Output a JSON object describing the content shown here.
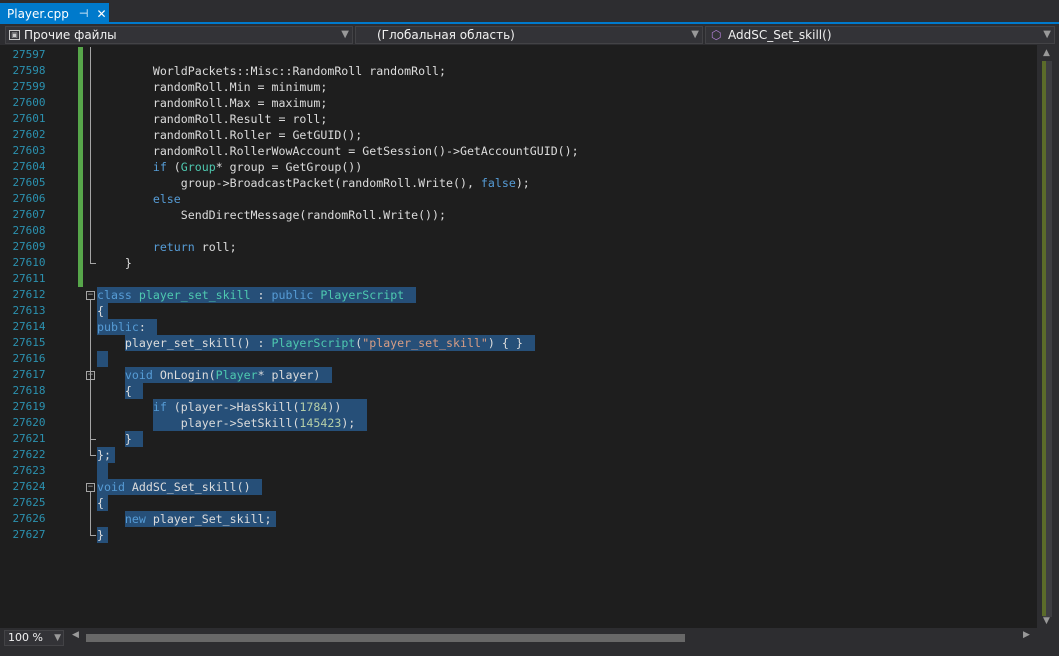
{
  "tab": {
    "title": "Player.cpp",
    "pin": "⊣",
    "close": "✕"
  },
  "navbar": {
    "project": "Прочие файлы",
    "scope": "(Глобальная область)",
    "member": "AddSC_Set_skill()"
  },
  "zoom": "100 %",
  "lines": [
    {
      "n": "27597",
      "s": []
    },
    {
      "n": "27598",
      "s": [
        [
          "t",
          "        WorldPackets::Misc::RandomRoll randomRoll;"
        ]
      ]
    },
    {
      "n": "27599",
      "s": [
        [
          "t",
          "        randomRoll.Min = minimum;"
        ]
      ]
    },
    {
      "n": "27600",
      "s": [
        [
          "t",
          "        randomRoll.Max = maximum;"
        ]
      ]
    },
    {
      "n": "27601",
      "s": [
        [
          "t",
          "        randomRoll.Result = roll;"
        ]
      ]
    },
    {
      "n": "27602",
      "s": [
        [
          "t",
          "        randomRoll.Roller = GetGUID();"
        ]
      ]
    },
    {
      "n": "27603",
      "s": [
        [
          "t",
          "        randomRoll.RollerWowAccount = GetSession()->GetAccountGUID();"
        ]
      ]
    },
    {
      "n": "27604",
      "s": [
        [
          "k",
          "        if"
        ],
        [
          "t",
          " ("
        ],
        [
          "y",
          "Group"
        ],
        [
          "t",
          "* group = GetGroup())"
        ]
      ]
    },
    {
      "n": "27605",
      "s": [
        [
          "t",
          "            group->BroadcastPacket(randomRoll.Write(), "
        ],
        [
          "k",
          "false"
        ],
        [
          "t",
          ");"
        ]
      ]
    },
    {
      "n": "27606",
      "s": [
        [
          "k",
          "        else"
        ]
      ]
    },
    {
      "n": "27607",
      "s": [
        [
          "t",
          "            SendDirectMessage(randomRoll.Write());"
        ]
      ]
    },
    {
      "n": "27608",
      "s": []
    },
    {
      "n": "27609",
      "s": [
        [
          "k",
          "        return"
        ],
        [
          "t",
          " roll;"
        ]
      ]
    },
    {
      "n": "27610",
      "s": [
        [
          "t",
          "    }"
        ]
      ]
    },
    {
      "n": "27611",
      "s": []
    },
    {
      "n": "27612",
      "s": [
        [
          "k",
          "class"
        ],
        [
          "t",
          " "
        ],
        [
          "y",
          "player_set_skill"
        ],
        [
          "t",
          " : "
        ],
        [
          "k",
          "public"
        ],
        [
          "t",
          " "
        ],
        [
          "y",
          "PlayerScript"
        ]
      ]
    },
    {
      "n": "27613",
      "s": [
        [
          "t",
          "{"
        ]
      ]
    },
    {
      "n": "27614",
      "s": [
        [
          "k",
          "public"
        ],
        [
          "t",
          ":"
        ]
      ]
    },
    {
      "n": "27615",
      "s": [
        [
          "t",
          "    player_set_skill() : "
        ],
        [
          "y",
          "PlayerScript"
        ],
        [
          "t",
          "("
        ],
        [
          "s",
          "\"player_set_skill\""
        ],
        [
          "t",
          ") { }"
        ]
      ]
    },
    {
      "n": "27616",
      "s": []
    },
    {
      "n": "27617",
      "s": [
        [
          "k",
          "    void"
        ],
        [
          "t",
          " OnLogin("
        ],
        [
          "y",
          "Player"
        ],
        [
          "t",
          "* player)"
        ]
      ]
    },
    {
      "n": "27618",
      "s": [
        [
          "t",
          "    {"
        ]
      ]
    },
    {
      "n": "27619",
      "s": [
        [
          "k",
          "        if"
        ],
        [
          "t",
          " (player->HasSkill("
        ],
        [
          "n",
          "1784"
        ],
        [
          "t",
          "))"
        ]
      ]
    },
    {
      "n": "27620",
      "s": [
        [
          "t",
          "            player->SetSkill("
        ],
        [
          "n",
          "145423"
        ],
        [
          "t",
          ");"
        ]
      ]
    },
    {
      "n": "27621",
      "s": [
        [
          "t",
          "    }"
        ]
      ]
    },
    {
      "n": "27622",
      "s": [
        [
          "t",
          "};"
        ]
      ]
    },
    {
      "n": "27623",
      "s": []
    },
    {
      "n": "27624",
      "s": [
        [
          "k",
          "void"
        ],
        [
          "t",
          " AddSC_Set_skill()"
        ]
      ]
    },
    {
      "n": "27625",
      "s": [
        [
          "t",
          "{"
        ]
      ]
    },
    {
      "n": "27626",
      "s": [
        [
          "k",
          "    new"
        ],
        [
          "t",
          " player_Set_skill;"
        ]
      ]
    },
    {
      "n": "27627",
      "s": [
        [
          "t",
          "}"
        ]
      ]
    }
  ]
}
